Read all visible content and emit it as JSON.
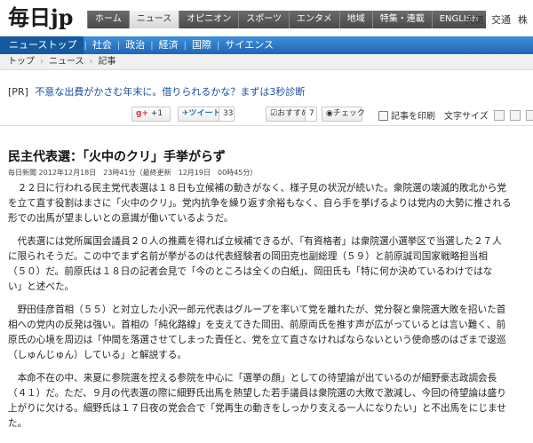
{
  "masthead": {
    "logo": "毎日jp",
    "tabs": [
      "ホーム",
      "ニュース",
      "オピニオン",
      "スポーツ",
      "エンタメ",
      "地域",
      "特集・連載",
      "ENGLISH"
    ],
    "active_tab": 1,
    "util": [
      "天気",
      "交通",
      "株"
    ]
  },
  "subnav": {
    "items": [
      "ニューストップ",
      "社会",
      "政治",
      "経済",
      "国際",
      "サイエンス"
    ]
  },
  "breadcrumb": [
    "トップ",
    "ニュース",
    "記事"
  ],
  "pr": {
    "tag": "[PR]",
    "text": "不意な出費がかさむ年末に。借りられるかな？まずは3秒診断"
  },
  "social": {
    "gplus_label": "g+",
    "gplus_count": "+1",
    "tweet_label": "ツイート",
    "tweet_count": "33",
    "osusume_label": "おすすめ",
    "osusume_count": "7",
    "check_label": "チェック",
    "print_label": "記事を印刷",
    "fontsize_label": "文字サイズ"
  },
  "article": {
    "title": "民主代表選：「火中のクリ」手挙がらず",
    "source": "毎日新聞",
    "date": "2012年12月18日　23時41分（最終更新　12月19日　00時45分）",
    "paragraphs": [
      "２２日に行われる民主党代表選は１８日も立候補の動きがなく、様子見の状況が続いた。衆院選の壊滅的敗北から党\nを立て直す役割はまさに「火中のクリ」。党内抗争を繰り返す余裕もなく、自ら手を挙げるよりは党内の大勢に推される\n形での出馬が望ましいとの意識が働いているようだ。",
      "代表選には党所属国会議員２０人の推薦を得れば立候補できるが、「有資格者」は衆院選小選挙区で当選した２７人\nに限られそうだ。この中でまず名前が挙がるのは代表経験者の岡田克也副総理（５９）と前原誠司国家戦略担当相\n（５０）だ。前原氏は１８日の記者会見で「今のところは全くの白紙」、岡田氏も「特に何か決めているわけではな\nい」と述べた。",
      "野田佳彦首相（５５）と対立した小沢一郎元代表はグループを率いて党を離れたが、党分裂と衆院選大敗を招いた首\n相への党内の反発は強い。首相の「純化路線」を支えてきた岡田、前原両氏を推す声が広がっているとは言い難く、前\n原氏の心境を周辺は「仲間を落選させてしまった責任と、党を立て直さなければならないという使命感のはざまで逡巡\n（しゅんじゅん）している」と解説する。",
      "本命不在の中、来夏に参院選を控える参院を中心に「選挙の顔」としての待望論が出ているのが細野豪志政調会長\n（４１）だ。ただ、９月の代表選の際に細野氏出馬を熱望した若手議員は衆院選の大敗で激減し、今回の待望論は盛り\n上がりに欠ける。細野氏は１７日夜の党会合で「党再生の動きをしっかり支える一人になりたい」と不出馬をにじませ\nた。"
    ]
  }
}
